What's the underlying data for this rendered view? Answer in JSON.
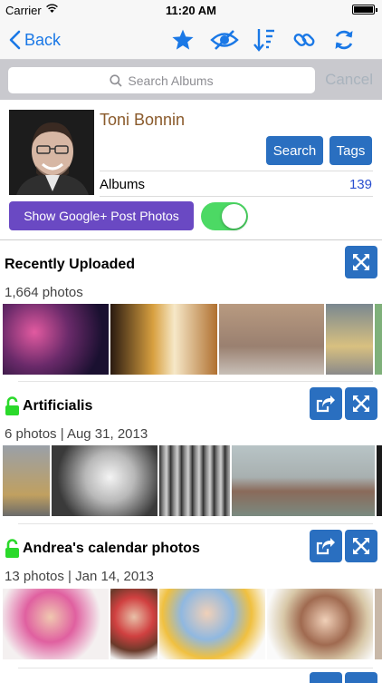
{
  "status_bar": {
    "carrier": "Carrier",
    "time": "11:20 AM"
  },
  "nav": {
    "back_label": "Back"
  },
  "search": {
    "placeholder": "Search Albums",
    "cancel_label": "Cancel"
  },
  "profile": {
    "name": "Toni Bonnin",
    "search_button": "Search",
    "tags_button": "Tags",
    "albums_label": "Albums",
    "albums_count": "139",
    "google_plus_button": "Show Google+ Post Photos",
    "toggle_on": true
  },
  "sections": [
    {
      "title": "Recently Uploaded",
      "subtitle": "1,664 photos",
      "locked": false
    },
    {
      "title": "Artificialis",
      "subtitle": "6 photos | Aug 31, 2013",
      "locked": true
    },
    {
      "title": "Andrea's calendar photos",
      "subtitle": "13 photos | Jan 14, 2013",
      "locked": true
    }
  ],
  "colors": {
    "accent": "#1a78e6",
    "button_blue": "#2a6fc0",
    "purple": "#6a49c3",
    "toggle_green": "#4cd964",
    "lock_green": "#2bd92b"
  }
}
